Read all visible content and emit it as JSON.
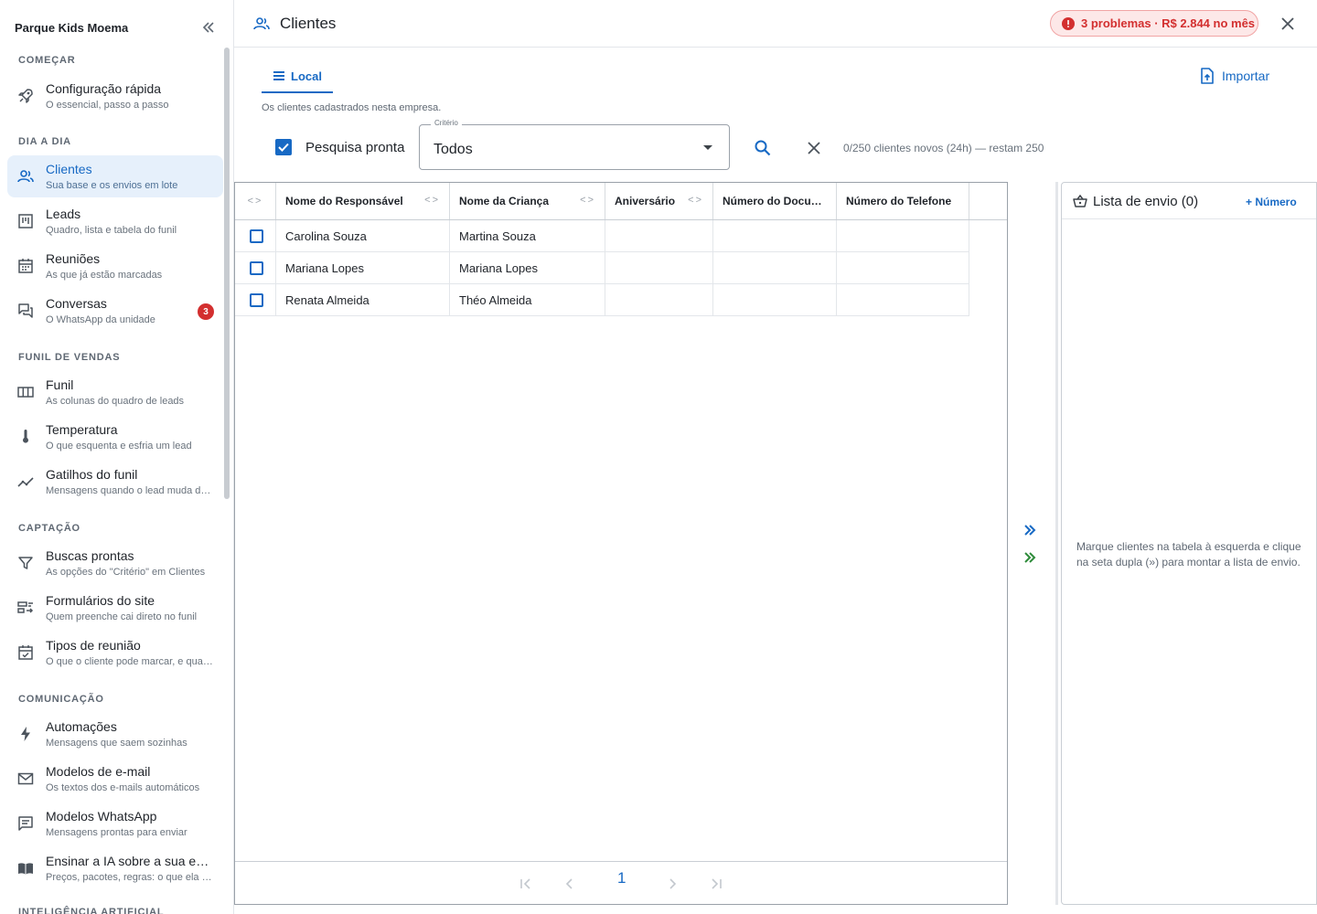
{
  "brand": "Parque Kids Moema",
  "sidebar": {
    "sections": [
      {
        "label": "COMEÇAR"
      },
      {
        "label": "DIA A DIA"
      },
      {
        "label": "FUNIL DE VENDAS"
      },
      {
        "label": "CAPTAÇÃO"
      },
      {
        "label": "COMUNICAÇÃO"
      },
      {
        "label": "INTELIGÊNCIA ARTIFICIAL"
      }
    ],
    "items": [
      {
        "title": "Configuração rápida",
        "subtitle": "O essencial, passo a passo",
        "icon": "rocket-icon"
      },
      {
        "title": "Clientes",
        "subtitle": "Sua base e os envios em lote",
        "icon": "people-icon",
        "active": true
      },
      {
        "title": "Leads",
        "subtitle": "Quadro, lista e tabela do funil",
        "icon": "board-icon"
      },
      {
        "title": "Reuniões",
        "subtitle": "As que já estão marcadas",
        "icon": "calendar-icon"
      },
      {
        "title": "Conversas",
        "subtitle": "O WhatsApp da unidade",
        "icon": "chat-icon",
        "badge": "3"
      },
      {
        "title": "Funil",
        "subtitle": "As colunas do quadro de leads",
        "icon": "columns-icon"
      },
      {
        "title": "Temperatura",
        "subtitle": "O que esquenta e esfria um lead",
        "icon": "thermometer-icon"
      },
      {
        "title": "Gatilhos do funil",
        "subtitle": "Mensagens quando o lead muda de etapa",
        "icon": "trend-icon"
      },
      {
        "title": "Buscas prontas",
        "subtitle": "As opções do \"Critério\" em Clientes",
        "icon": "filter-icon"
      },
      {
        "title": "Formulários do site",
        "subtitle": "Quem preenche cai direto no funil",
        "icon": "form-icon"
      },
      {
        "title": "Tipos de reunião",
        "subtitle": "O que o cliente pode marcar, e quando",
        "icon": "calendar-check-icon"
      },
      {
        "title": "Automações",
        "subtitle": "Mensagens que saem sozinhas",
        "icon": "bolt-icon"
      },
      {
        "title": "Modelos de e-mail",
        "subtitle": "Os textos dos e-mails automáticos",
        "icon": "mail-icon"
      },
      {
        "title": "Modelos WhatsApp",
        "subtitle": "Mensagens prontas para enviar",
        "icon": "message-icon"
      },
      {
        "title": "Ensinar a IA sobre a sua empresa",
        "subtitle": "Preços, pacotes, regras: o que ela precisa saber",
        "icon": "book-icon"
      }
    ]
  },
  "header": {
    "title": "Clientes",
    "problems": "3 problemas · R$ 2.844 no mês"
  },
  "tabs": {
    "local": "Local"
  },
  "importar": "Importar",
  "description": "Os clientes cadastrados nesta empresa.",
  "search": {
    "checkbox_label": "Pesquisa pronta",
    "criterio_label": "Critério",
    "criterio_value": "Todos",
    "quota": "0/250 clientes novos (24h) — restam 250"
  },
  "table": {
    "columns": [
      "Nome do Responsável",
      "Nome da Criança",
      "Aniversário",
      "Número do Documento",
      "Número do Telefone"
    ],
    "rows": [
      [
        "Carolina Souza",
        "Martina Souza",
        "",
        "",
        ""
      ],
      [
        "Mariana Lopes",
        "Mariana Lopes",
        "",
        "",
        ""
      ],
      [
        "Renata Almeida",
        "Théo Almeida",
        "",
        "",
        ""
      ]
    ],
    "page": "1"
  },
  "send_list": {
    "title": "Lista de envio (0)",
    "add_number": "+ Número",
    "empty_text": "Marque clientes na tabela à esquerda e clique na seta dupla (») para montar a lista de envio."
  },
  "colors": {
    "accent": "#1769c4",
    "active_bg": "#e6f0fb",
    "danger": "#d32f2f",
    "danger_bg": "#fde8e8",
    "green_arrow": "#2e8b3a"
  }
}
